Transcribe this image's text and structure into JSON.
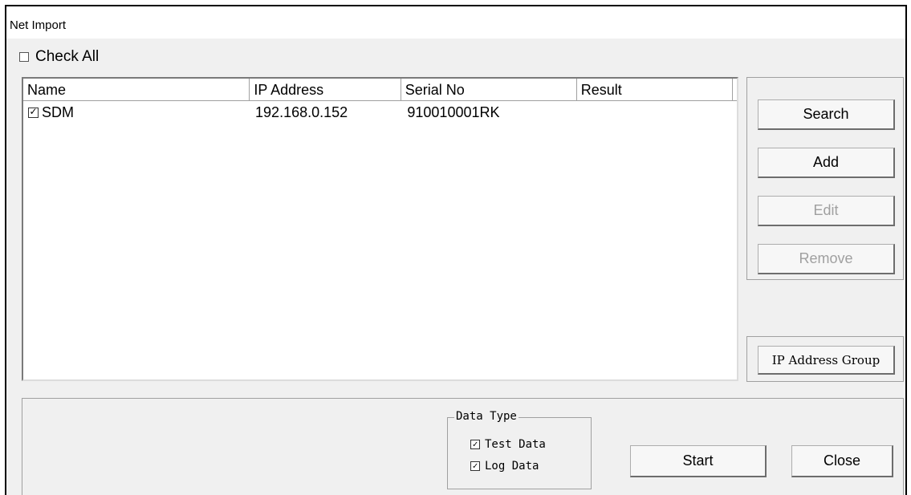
{
  "window": {
    "title": "Net Import"
  },
  "check_all": {
    "label": "Check All",
    "checked": false
  },
  "list": {
    "columns": [
      "Name",
      "IP Address",
      "Serial No",
      "Result"
    ],
    "rows": [
      {
        "checked": true,
        "name": "SDM",
        "ip": "192.168.0.152",
        "serial": "910010001RK",
        "result": ""
      }
    ]
  },
  "buttons": {
    "search": "Search",
    "add": "Add",
    "edit": "Edit",
    "remove": "Remove",
    "ip_group": "IP Address Group",
    "start": "Start",
    "close": "Close"
  },
  "data_type": {
    "label": "Data Type",
    "test_data": {
      "label": "Test Data",
      "checked": true
    },
    "log_data": {
      "label": "Log Data",
      "checked": true
    }
  }
}
